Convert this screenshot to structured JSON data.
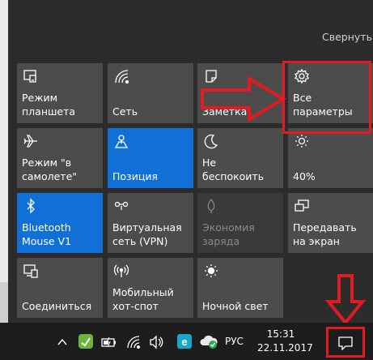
{
  "header": {
    "collapse_label": "Свернуть"
  },
  "tiles": [
    {
      "label": "Режим\nпланшета",
      "icon": "tablet-mode-icon",
      "state": "normal"
    },
    {
      "label": "Сеть",
      "icon": "wifi-network-icon",
      "state": "normal"
    },
    {
      "label": "Заметка",
      "icon": "note-icon",
      "state": "normal"
    },
    {
      "label": "Все\nпараметры",
      "icon": "gear-icon",
      "state": "normal"
    },
    {
      "label": "Режим \"в\nсамолете\"",
      "icon": "airplane-icon",
      "state": "normal"
    },
    {
      "label": "Позиция",
      "icon": "location-icon",
      "state": "active"
    },
    {
      "label": "Не\nбеспокоить",
      "icon": "moon-icon",
      "state": "normal"
    },
    {
      "label": "40%",
      "icon": "brightness-icon",
      "state": "normal"
    },
    {
      "label": "Bluetooth\nMouse V1",
      "icon": "bluetooth-icon",
      "state": "active"
    },
    {
      "label": "Виртуальная\nсеть (VPN)",
      "icon": "vpn-icon",
      "state": "normal"
    },
    {
      "label": "Экономия\nзаряда",
      "icon": "battery-saver-icon",
      "state": "disabled"
    },
    {
      "label": "Передавать\nна экран",
      "icon": "project-icon",
      "state": "normal"
    },
    {
      "label": "Соединиться",
      "icon": "connect-icon",
      "state": "normal"
    },
    {
      "label": "Мобильный\nхот-спот",
      "icon": "hotspot-icon",
      "state": "normal"
    },
    {
      "label": "Ночной свет",
      "icon": "night-light-icon",
      "state": "normal"
    }
  ],
  "taskbar": {
    "language": "РУС",
    "time": "15:31",
    "date": "22.11.2017",
    "tray_icons": [
      "chevron-up-icon",
      "leaf-app-icon",
      "battery-icon",
      "wifi-icon",
      "volume-icon",
      "e-app-icon",
      "cloud-sync-icon"
    ]
  },
  "colors": {
    "accent": "#1070d6",
    "tile": "#4c4c4c",
    "annotation": "#e21a22"
  }
}
